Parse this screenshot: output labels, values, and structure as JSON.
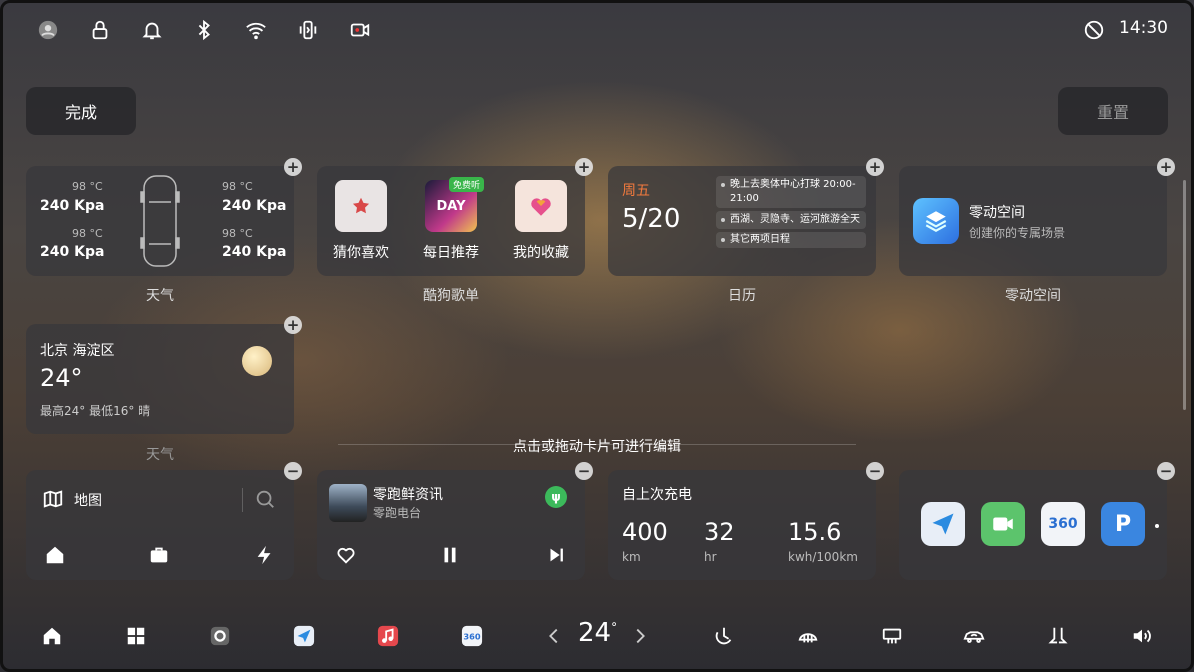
{
  "status_bar": {
    "icons": [
      "avatar-icon",
      "lock-icon",
      "bell-icon",
      "bluetooth-icon",
      "wifi-icon",
      "vibrate-icon",
      "camera-record-icon",
      "no-signal-icon"
    ],
    "time": "14:30"
  },
  "top_buttons": {
    "done": "完成",
    "reset": "重置"
  },
  "tire_card": {
    "fl_temp": "98 °C",
    "fl_pressure": "240 Kpa",
    "fr_temp": "98 °C",
    "fr_pressure": "240 Kpa",
    "rl_temp": "98 °C",
    "rl_pressure": "240 Kpa",
    "rr_temp": "98 °C",
    "rr_pressure": "240 Kpa",
    "caption": "天气"
  },
  "music_card": {
    "items": [
      "猜你喜欢",
      "每日推荐",
      "我的收藏"
    ],
    "badge": "免费听",
    "caption": "酷狗歌单"
  },
  "calendar_card": {
    "weekday": "周五",
    "date": "5/20",
    "events": [
      "晚上去奥体中心打球 20:00-21:00",
      "西湖、灵隐寺、运河旅游全天",
      "其它两项日程"
    ],
    "caption": "日历"
  },
  "space_card": {
    "title": "零动空间",
    "subtitle": "创建你的专属场景",
    "caption": "零动空间"
  },
  "weather_card": {
    "location": "北京 海淀区",
    "temp": "24°",
    "range": "最高24° 最低16° 晴",
    "caption": "天气"
  },
  "hint": "点击或拖动卡片可进行编辑",
  "map_card": {
    "label": "地图"
  },
  "radio_card": {
    "title": "零跑鲜资讯",
    "subtitle": "零跑电台"
  },
  "charge_card": {
    "title": "自上次充电",
    "stats": [
      {
        "value": "400",
        "unit": "km"
      },
      {
        "value": "32",
        "unit": "hr"
      },
      {
        "value": "15.6",
        "unit": "kwh/100km"
      }
    ]
  },
  "apps_card": {
    "apps": [
      {
        "name": "导航",
        "icon": "send-icon",
        "color": "#e8eef7"
      },
      {
        "name": "视频",
        "icon": "video-icon",
        "color": "#5cc46c"
      },
      {
        "name": "360",
        "icon": "camera-360-icon",
        "color": "#f2f4f8"
      },
      {
        "name": "P",
        "icon": "parking-icon",
        "color": "#3a86e0"
      }
    ]
  },
  "dock": {
    "temperature": "24",
    "icons": [
      "home-icon",
      "apps-grid-icon",
      "settings-icon",
      "nav-app-icon",
      "music-app-icon",
      "camera-360-icon",
      "ac-auto-icon",
      "front-defrost-icon",
      "rear-defrost-icon",
      "recirculation-icon",
      "seat-icon",
      "volume-icon"
    ]
  }
}
